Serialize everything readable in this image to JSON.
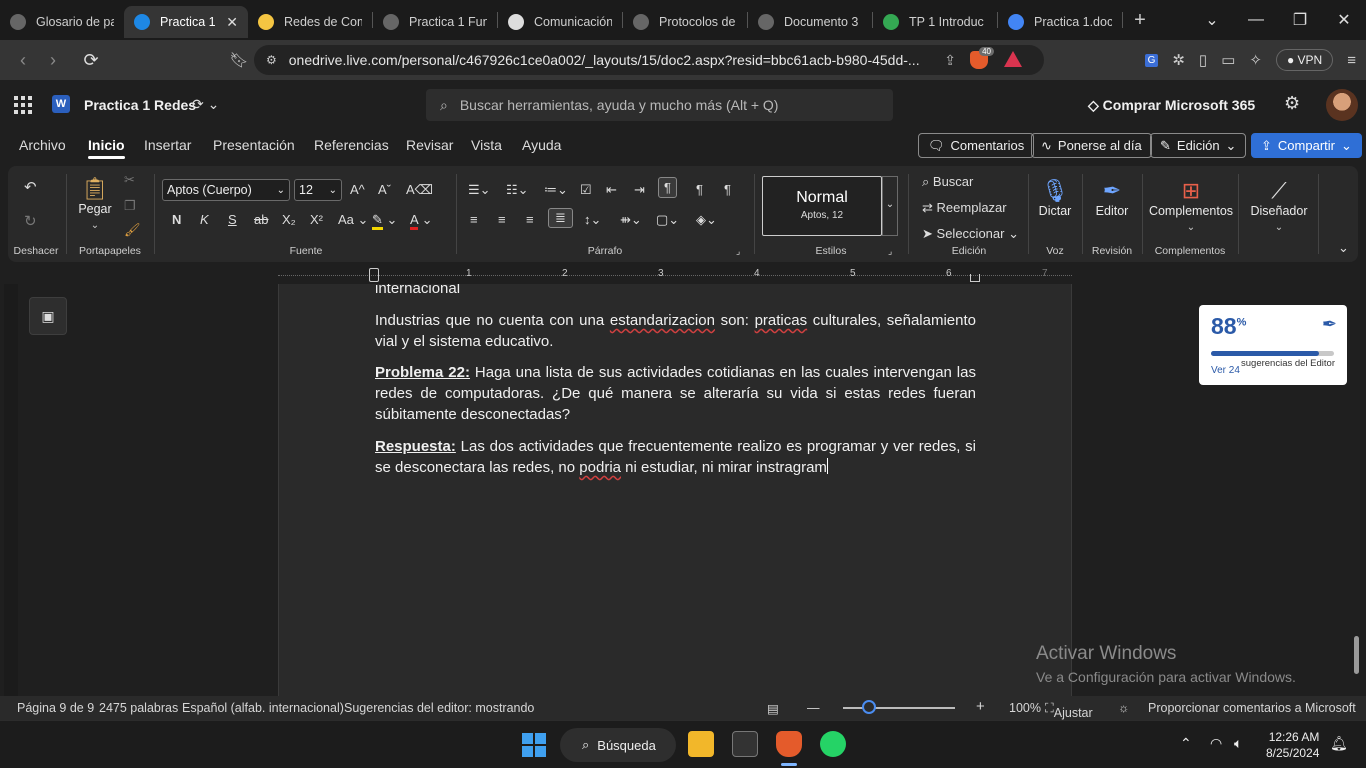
{
  "browser": {
    "tabs": [
      {
        "title": "Glosario de pa",
        "icon": "globe-icon",
        "active": false
      },
      {
        "title": "Practica 1",
        "icon": "onedrive-icon",
        "active": true
      },
      {
        "title": "Redes de Com",
        "icon": "slides-icon",
        "active": false
      },
      {
        "title": "Practica 1 Fun",
        "icon": "globe-icon",
        "active": false
      },
      {
        "title": "Comunicación",
        "icon": "chatgpt-icon",
        "active": false
      },
      {
        "title": "Protocolos de",
        "icon": "globe-icon",
        "active": false
      },
      {
        "title": "Documento 3",
        "icon": "globe-icon",
        "active": false
      },
      {
        "title": "TP 1 Introduc",
        "icon": "drive-icon",
        "active": false
      },
      {
        "title": "Practica 1.doc",
        "icon": "docs-icon",
        "active": false
      }
    ],
    "url": "onedrive.live.com/personal/c467926c1ce0a002/_layouts/15/doc2.aspx?resid=bbc61acb-b980-45dd-...",
    "brave_badge": "40",
    "vpn_label": "VPN"
  },
  "word": {
    "app_letter": "W",
    "doc_title": "Practica 1 Redes",
    "search_placeholder": "Buscar herramientas, ayuda y mucho más (Alt + Q)",
    "buy_label": "Comprar Microsoft 365",
    "menu": [
      "Archivo",
      "Inicio",
      "Insertar",
      "Presentación",
      "Referencias",
      "Revisar",
      "Vista",
      "Ayuda"
    ],
    "active_menu": "Inicio",
    "actions": {
      "comments": "Comentarios",
      "catch_up": "Ponerse al día",
      "editing": "Edición",
      "share": "Compartir"
    },
    "ribbon": {
      "undo_group": "Deshacer",
      "paste_label": "Pegar",
      "clipboard_group": "Portapapeles",
      "font_name": "Aptos (Cuerpo)",
      "font_size": "12",
      "font_group": "Fuente",
      "paragraph_group": "Párrafo",
      "style_name": "Normal",
      "style_font": "Aptos, 12",
      "styles_group": "Estilos",
      "find": "Buscar",
      "replace": "Reemplazar",
      "select": "Seleccionar",
      "editing_group": "Edición",
      "dictate": "Dictar",
      "voice_group": "Voz",
      "editor": "Editor",
      "review_group": "Revisión",
      "addins": "Complementos",
      "addins_group": "Complementos",
      "designer": "Diseñador",
      "format_buttons": {
        "bold": "N",
        "italic": "K",
        "underline": "S",
        "strike": "ab",
        "subscript": "X₂",
        "superscript": "X²"
      }
    },
    "ruler_numbers": [
      "1",
      "2",
      "3",
      "4",
      "5",
      "6",
      "7"
    ]
  },
  "document": {
    "partial_line": "internacional",
    "para1": "Industrias que no cuenta con una estandarizacion son: praticas culturales, señalamiento vial y el sistema educativo.",
    "para2_label": "Problema 22:",
    "para2": " Haga una lista de sus actividades cotidianas en las cuales intervengan las redes de computadoras. ¿De qué manera se alteraría su vida si estas redes fueran súbitamente desconectadas?",
    "para3_label": "Respuesta:",
    "para3": " Las dos actividades que frecuentemente realizo es programar y ver redes, si se desconectara las redes, no podria ni estudiar, ni mirar instragram"
  },
  "editor_card": {
    "score": "88",
    "score_unit": "%",
    "score_fraction": 0.88,
    "view_link": "Ver 24",
    "suggestions_text": "sugerencias del Editor"
  },
  "watermark": {
    "line1": "Activar Windows",
    "line2": "Ve a Configuración para activar Windows."
  },
  "statusbar": {
    "page": "Página 9 de 9",
    "words": "2475 palabras",
    "language": "Español (alfab. internacional)",
    "suggestions": "Sugerencias del editor: mostrando",
    "zoom": "100%",
    "fit": "Ajustar",
    "feedback": "Proporcionar comentarios a Microsoft"
  },
  "taskbar": {
    "search_label": "Búsqueda",
    "time": "12:26 AM",
    "date": "8/25/2024"
  }
}
